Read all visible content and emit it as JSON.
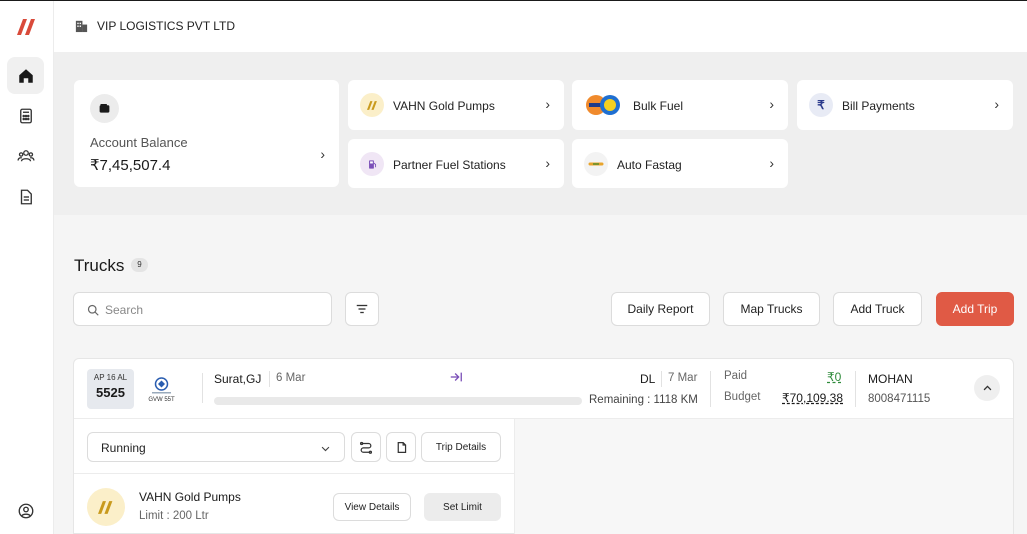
{
  "header": {
    "company": "VIP LOGISTICS PVT LTD"
  },
  "sidebar": {
    "items": [
      {
        "icon": "home-icon"
      },
      {
        "icon": "calculator-icon"
      },
      {
        "icon": "users-icon"
      },
      {
        "icon": "document-icon"
      }
    ],
    "bottom_icon": "user-circle-icon"
  },
  "account": {
    "label": "Account Balance",
    "value": "₹7,45,507.4"
  },
  "services": [
    {
      "label": "VAHN Gold Pumps",
      "icon": "vahn-logo-icon"
    },
    {
      "label": "Bulk Fuel",
      "icon": "fuel-brands-icon"
    },
    {
      "label": "Bill Payments",
      "icon": "rupee-icon"
    },
    {
      "label": "Partner Fuel Stations",
      "icon": "fuel-pump-icon"
    },
    {
      "label": "Auto Fastag",
      "icon": "fastag-icon"
    }
  ],
  "trucks": {
    "title": "Trucks",
    "count": "9",
    "search_placeholder": "Search",
    "buttons": {
      "daily_report": "Daily Report",
      "map_trucks": "Map Trucks",
      "add_truck": "Add Truck",
      "add_trip": "Add Trip"
    }
  },
  "trip": {
    "plate_top": "AP 16 AL",
    "plate_number": "5525",
    "truck_model": "GVW 55T",
    "from_city": "Surat,GJ",
    "from_date": "6 Mar",
    "to_city": "DL",
    "to_date": "7 Mar",
    "remaining": "Remaining : 1118 KM",
    "progress_fraction": 0.0,
    "paid_label": "Paid",
    "paid_value": "₹0",
    "budget_label": "Budget",
    "budget_value": "₹70,109.38",
    "driver_name": "MOHAN",
    "driver_phone": "8008471115",
    "status": "Running",
    "trip_details": "Trip Details",
    "pump": {
      "name": "VAHN Gold Pumps",
      "limit": "Limit : 200 Ltr",
      "view": "View Details",
      "set_limit": "Set Limit"
    }
  },
  "colors": {
    "accent": "#e05a45",
    "paid_green": "#2e8b3a",
    "logo_red": "#d94a3a",
    "route_purple": "#7b4fb8"
  }
}
